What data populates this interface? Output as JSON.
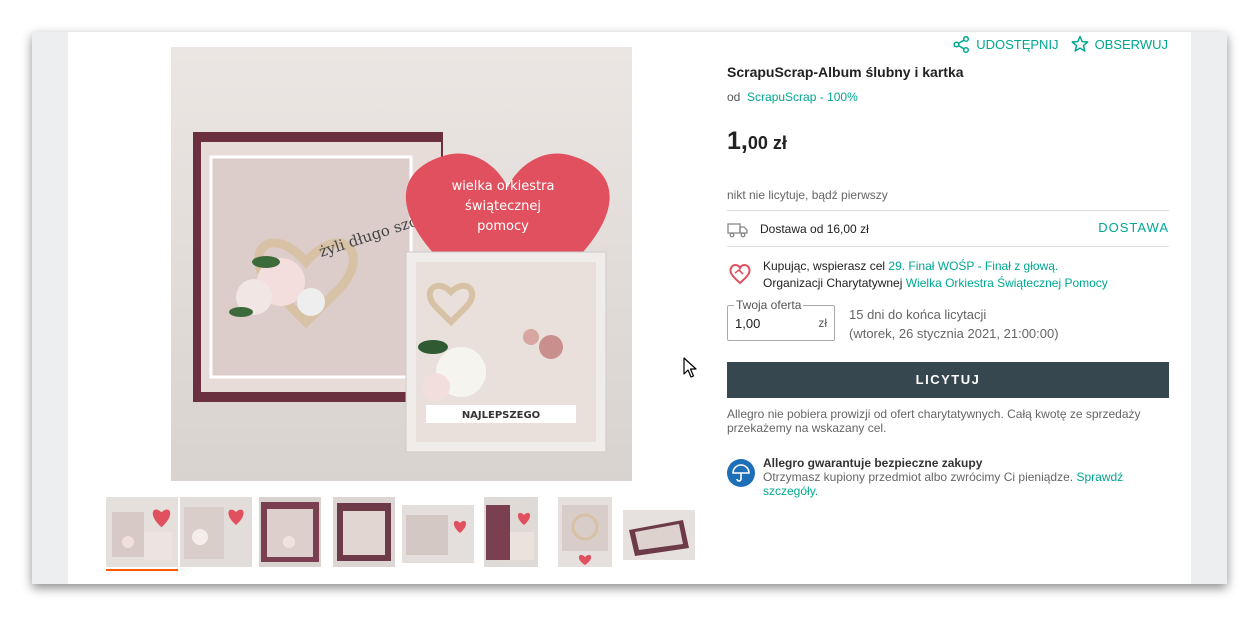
{
  "header": {
    "share_label": "UDOSTĘPNIJ",
    "watch_label": "OBSERWUJ"
  },
  "product": {
    "title": "ScrapuScrap-Album ślubny i kartka",
    "seller_prefix": "od",
    "seller_link": "ScrapuScrap - 100%",
    "price_main": "1,",
    "price_fraction": "00 zł",
    "bids_status": "nikt nie licytuje, bądź pierwszy"
  },
  "photo": {
    "heart_line1": "wielka orkiestra",
    "heart_line2": "świątecznej",
    "heart_line3": "pomocy",
    "banner_text": "NAJLEPSZEGO",
    "album_text": "żyli długo szczęśliwie"
  },
  "thumbnails": [
    {
      "name": "thumb-1",
      "active": true
    },
    {
      "name": "thumb-2",
      "active": false
    },
    {
      "name": "thumb-3",
      "active": false
    },
    {
      "name": "thumb-4",
      "active": false
    },
    {
      "name": "thumb-5",
      "active": false
    },
    {
      "name": "thumb-6",
      "active": false
    },
    {
      "name": "thumb-7",
      "active": false
    },
    {
      "name": "thumb-8",
      "active": false
    }
  ],
  "delivery": {
    "text": "Dostawa od 16,00 zł",
    "link": "DOSTAWA"
  },
  "charity": {
    "line1_prefix": "Kupując, wspierasz cel",
    "line1_link": "29. Finał WOŚP - Finał z głową.",
    "line2_prefix": "Organizacji Charytatywnej",
    "line2_link": "Wielka Orkiestra Świątecznej Pomocy"
  },
  "offer": {
    "label": "Twoja oferta",
    "value": "1,00",
    "currency": "zł"
  },
  "auction": {
    "time_left": "15 dni do końca licytacji",
    "end_date": "(wtorek, 26 stycznia 2021, 21:00:00)"
  },
  "actions": {
    "bid_button": "LICYTUJ"
  },
  "note": "Allegro nie pobiera prowizji od ofert charytatywnych. Całą kwotę ze sprzedaży przekażemy na wskazany cel.",
  "guarantee": {
    "title": "Allegro gwarantuje bezpieczne zakupy",
    "body": "Otrzymasz kupiony przedmiot albo zwrócimy Ci pieniądze.",
    "link": "Sprawdź szczegóły."
  },
  "colors": {
    "accent": "#00a790",
    "button": "#36474f",
    "active_thumb": "#ff5a00",
    "guarantee_icon": "#1d6fb8",
    "heart": "#e0505f"
  }
}
